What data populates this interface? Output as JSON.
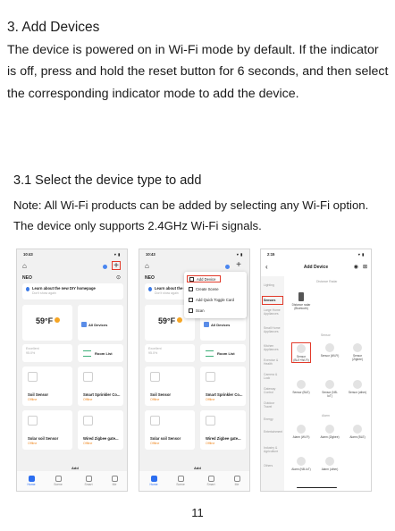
{
  "section": {
    "title": "3. Add Devices",
    "body": "The device is powered on in Wi-Fi mode by default. If the indicator is off, press and hold the reset button for 6 seconds, and then select the corresponding indicator mode to add the device."
  },
  "subsection": {
    "title": "3.1 Select the device type to add",
    "note": "Note: All Wi-Fi products can be added by selecting any Wi-Fi option. The device only supports 2.4GHz Wi-Fi signals."
  },
  "page_number": "11",
  "app": {
    "time": "10:43",
    "signal": "▾ ▮",
    "home_name": "NEO",
    "banner_title": "Learn about the new DIY homepage",
    "banner_sub": "Don't show again",
    "weather_temp": "59°F",
    "weather_detail_1": "Excellent",
    "weather_detail_2": "95.0%",
    "all_devices": "All Devices",
    "room_list": "Room List",
    "devices": [
      {
        "name": "Soil Sensor",
        "status": "Offline"
      },
      {
        "name": "Smart Sprinkler Co...",
        "status": "Offline"
      },
      {
        "name": "Solar soil Sensor",
        "status": "Offline"
      },
      {
        "name": "Wired Zigbee gate...",
        "status": "Offline"
      }
    ],
    "add_label": "Add",
    "tabs": [
      "Home",
      "Scene",
      "Smart",
      "Me"
    ],
    "menu": [
      "Add Device",
      "Create Scene",
      "Add Quick Toggle Card",
      "Scan"
    ]
  },
  "add_device_screen": {
    "time": "2:15",
    "title": "Add Device",
    "categories": [
      "Lighting",
      "Sensors",
      "Large Home Appliances",
      "Small Home Appliances",
      "Kitchen Appliances",
      "Exercise & Health",
      "Camera & Lock",
      "Gateway Control",
      "Outdoor Travel",
      "Energy",
      "Entertainment",
      "Industry & Agriculture",
      "Others"
    ],
    "groups": [
      "Distance Radar",
      "Sensor",
      "Alarm"
    ],
    "options": [
      "Distance radar (Bluetooth)",
      "Sensor (BLE+Wi-Fi)",
      "Sensor (Wi-Fi)",
      "Sensor (Zigbee)",
      "Sensor (BLE)",
      "Sensor (NB-IoT)",
      "Sensor (other)",
      "Alarm (Wi-Fi)",
      "Alarm (Zigbee)",
      "Alarm (BLE)",
      "Alarm (NB-IoT)",
      "Alarm (other)"
    ]
  },
  "colors": {
    "highlight": "#e23a2a",
    "accent": "#2c6ef0",
    "offline": "#f08a24"
  }
}
